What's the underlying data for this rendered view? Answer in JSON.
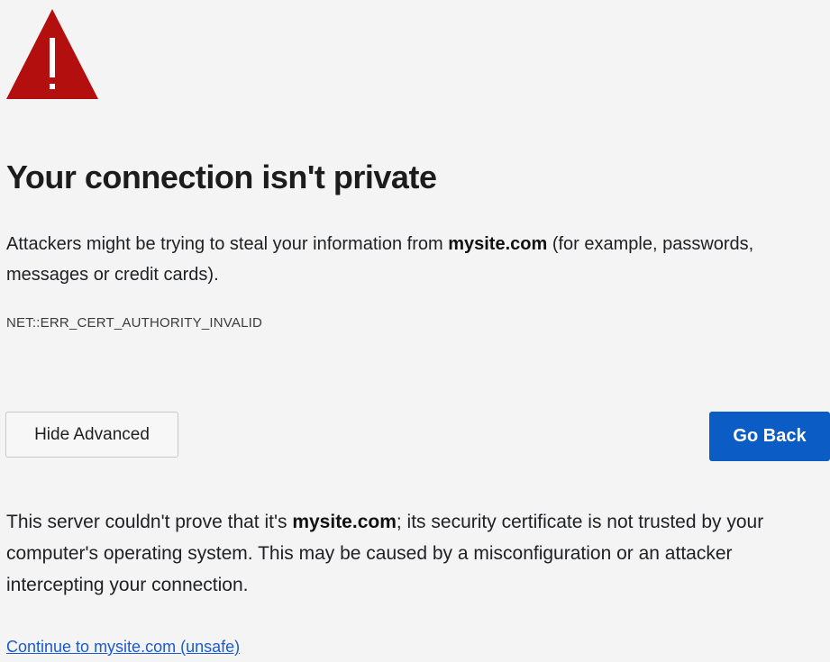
{
  "colors": {
    "warning": "#b30f0f",
    "primary_button": "#0b5cc4",
    "link": "#1a5bd0",
    "background": "#f4f4f4"
  },
  "icon": {
    "name": "warning-triangle-icon",
    "glyph": "!"
  },
  "title": "Your connection isn't private",
  "description": {
    "before": "Attackers might be trying to steal your information from ",
    "domain": "mysite.com",
    "after": " (for example, passwords, messages or credit cards)."
  },
  "error_code": "NET::ERR_CERT_AUTHORITY_INVALID",
  "buttons": {
    "advanced_label": "Hide Advanced",
    "back_label": "Go Back"
  },
  "details": {
    "before": "This server couldn't prove that it's ",
    "domain": "mysite.com",
    "after": "; its security certificate is not trusted by your computer's operating system. This may be caused by a misconfiguration or an attacker intercepting your connection."
  },
  "proceed_link": "Continue to mysite.com (unsafe)"
}
